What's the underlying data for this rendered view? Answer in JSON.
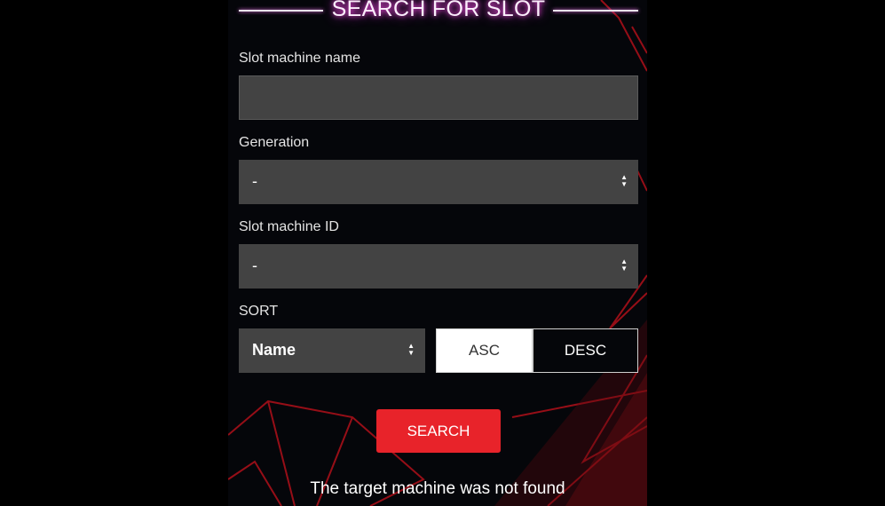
{
  "title": "SEARCH FOR SLOT",
  "form": {
    "name_label": "Slot machine name",
    "name_value": "",
    "generation_label": "Generation",
    "generation_value": "-",
    "id_label": "Slot machine ID",
    "id_value": "-",
    "sort_label": "SORT",
    "sort_value": "Name",
    "asc_label": "ASC",
    "desc_label": "DESC",
    "order_selected": "ASC",
    "search_label": "SEARCH"
  },
  "result_message": "The target machine was not found",
  "icons": {
    "select_arrows": "updown-arrows-icon"
  },
  "colors": {
    "accent": "#e8232a",
    "input_bg": "#434343",
    "page_bg": "#05060a",
    "title_glow": "#ff4fe8"
  }
}
